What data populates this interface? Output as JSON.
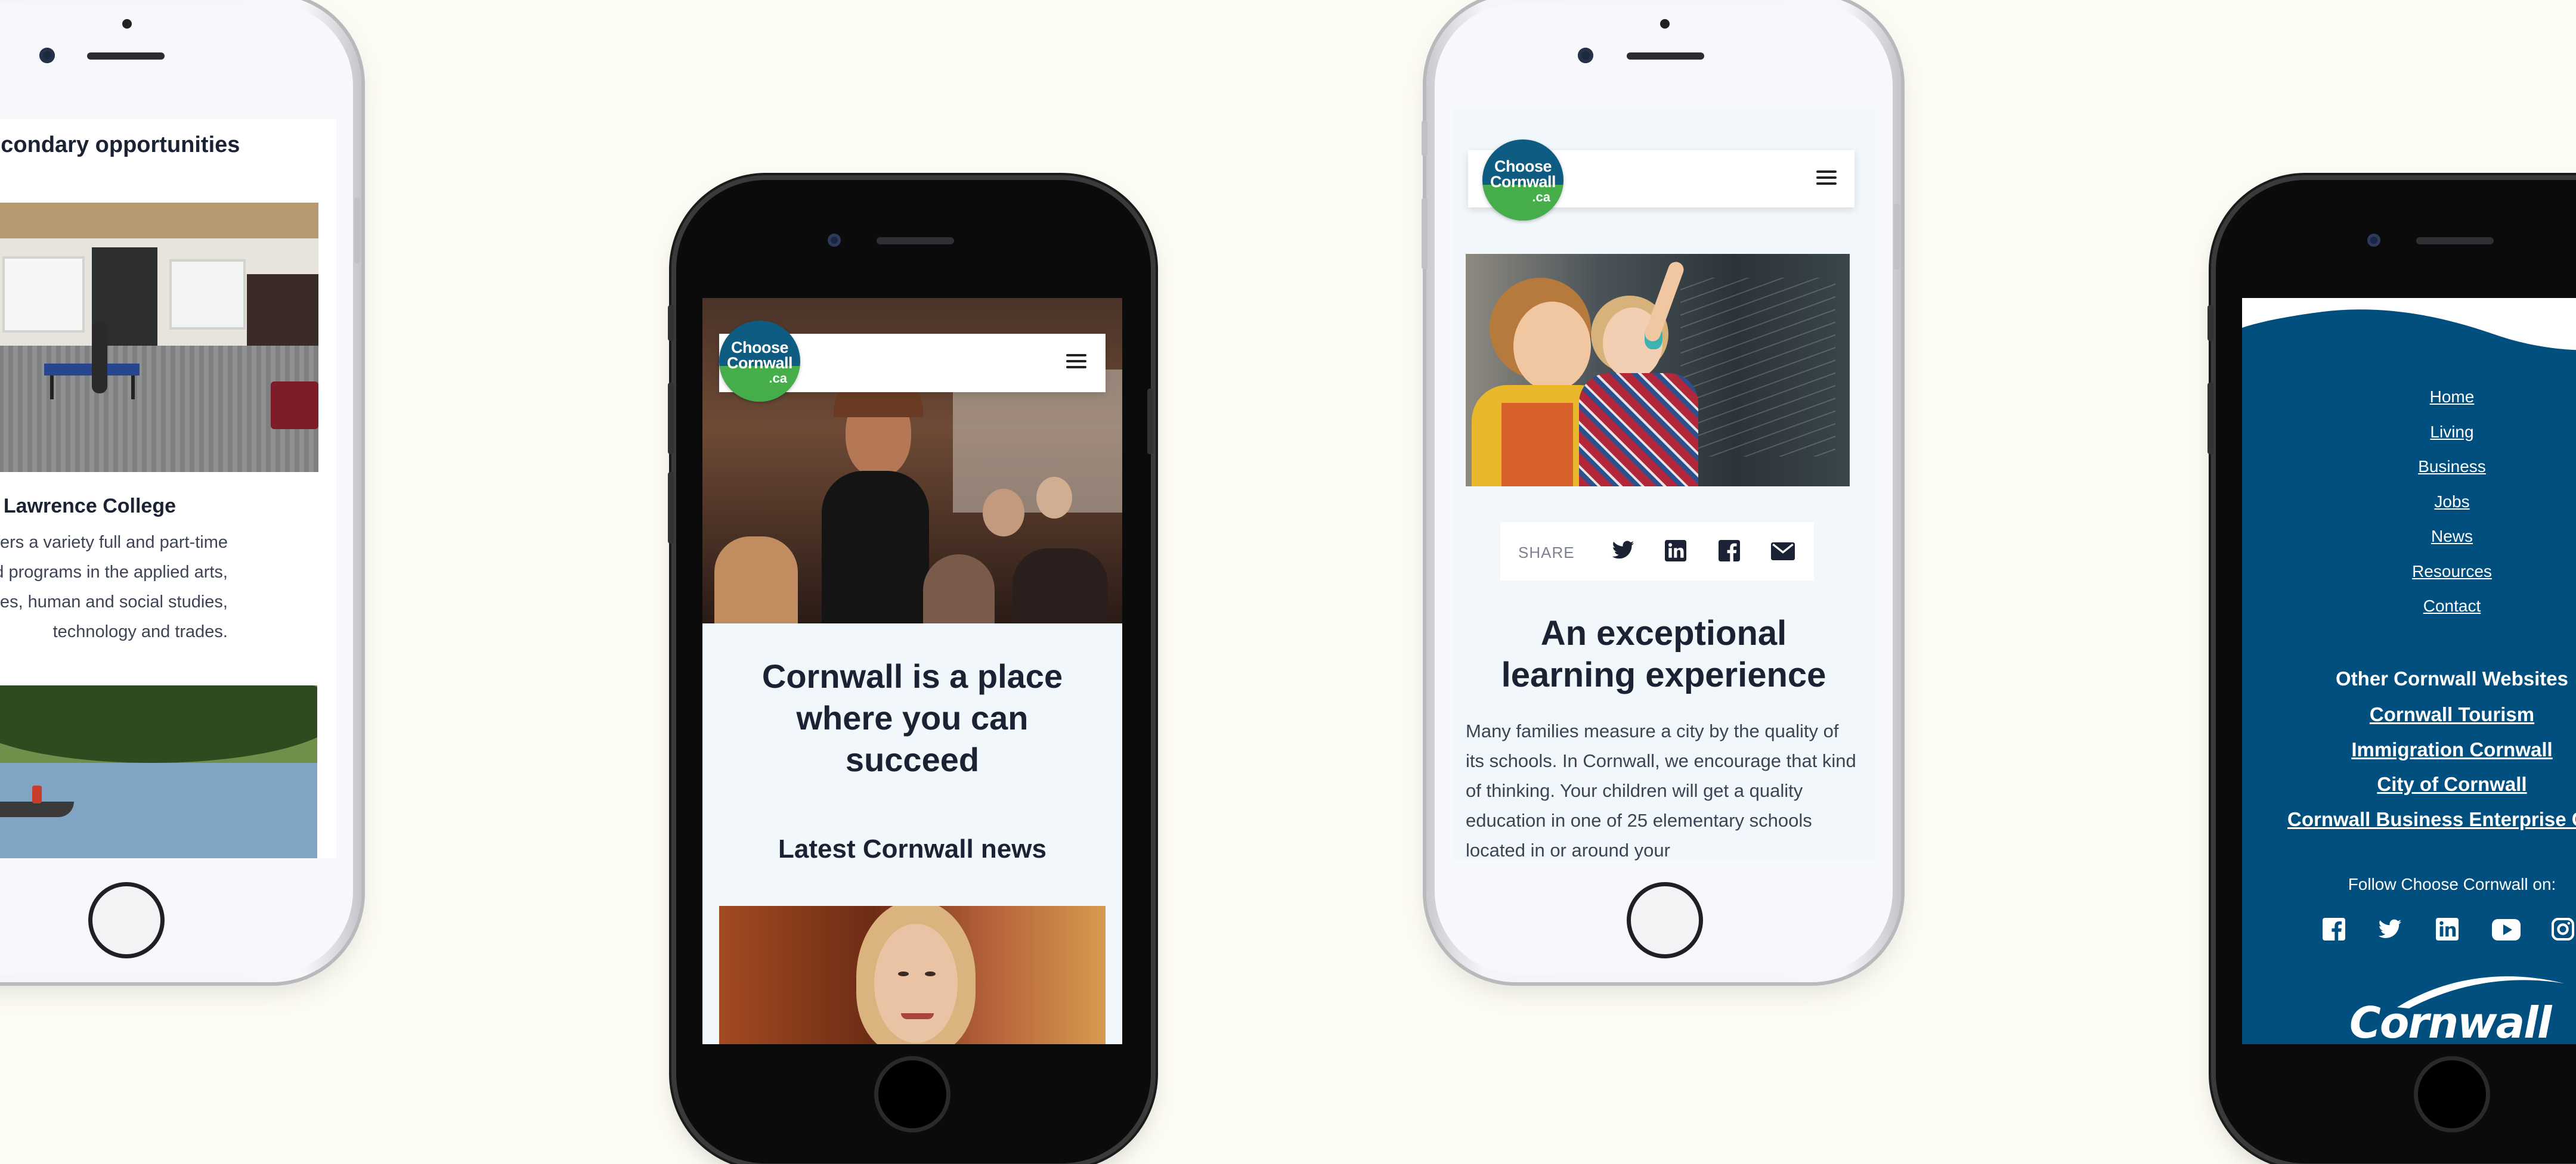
{
  "phone1": {
    "section_heading": "Post-secondary opportunities",
    "college_name": "St. Lawrence College",
    "college_text": "St. Lawrence College offers a variety full and part-time employer-needs based programs in the applied arts, business, health sciences, human and social studies, technology and trades."
  },
  "phone2": {
    "logo": {
      "line1": "Choose",
      "line2": "Cornwall",
      "line3": ".ca"
    },
    "headline": "Cornwall is a place where you can succeed",
    "news_heading": "Latest Cornwall news"
  },
  "phone3": {
    "logo": {
      "line1": "Choose",
      "line2": "Cornwall",
      "line3": ".ca"
    },
    "share_label": "SHARE",
    "share_icons": [
      "twitter-icon",
      "linkedin-icon",
      "facebook-icon",
      "email-icon"
    ],
    "headline": "An exceptional learning experience",
    "body": "Many families measure a city by the quality of its schools. In Cornwall, we encourage that kind of thinking. Your children will get a quality education in one of 25 elementary schools located in or around your"
  },
  "phone4": {
    "nav": [
      "Home",
      "Living",
      "Business",
      "Jobs",
      "News",
      "Resources",
      "Contact"
    ],
    "other_heading": "Other Cornwall Websites",
    "other_links": [
      "Cornwall Tourism",
      "Immigration Cornwall",
      "City of Cornwall",
      "Cornwall Business Enterprise Centre"
    ],
    "follow_text": "Follow Choose Cornwall on:",
    "social_icons": [
      "facebook-icon",
      "twitter-icon",
      "linkedin-icon",
      "youtube-icon",
      "instagram-icon"
    ],
    "footer_logo": "Cornwall"
  },
  "colors": {
    "background": "#fdfcf4",
    "navy": "#1b2233",
    "brand_blue": "#0f5c83",
    "brand_green": "#45ae4a",
    "footer_blue": "#004f7e",
    "light_panel": "#f1f7fb"
  }
}
